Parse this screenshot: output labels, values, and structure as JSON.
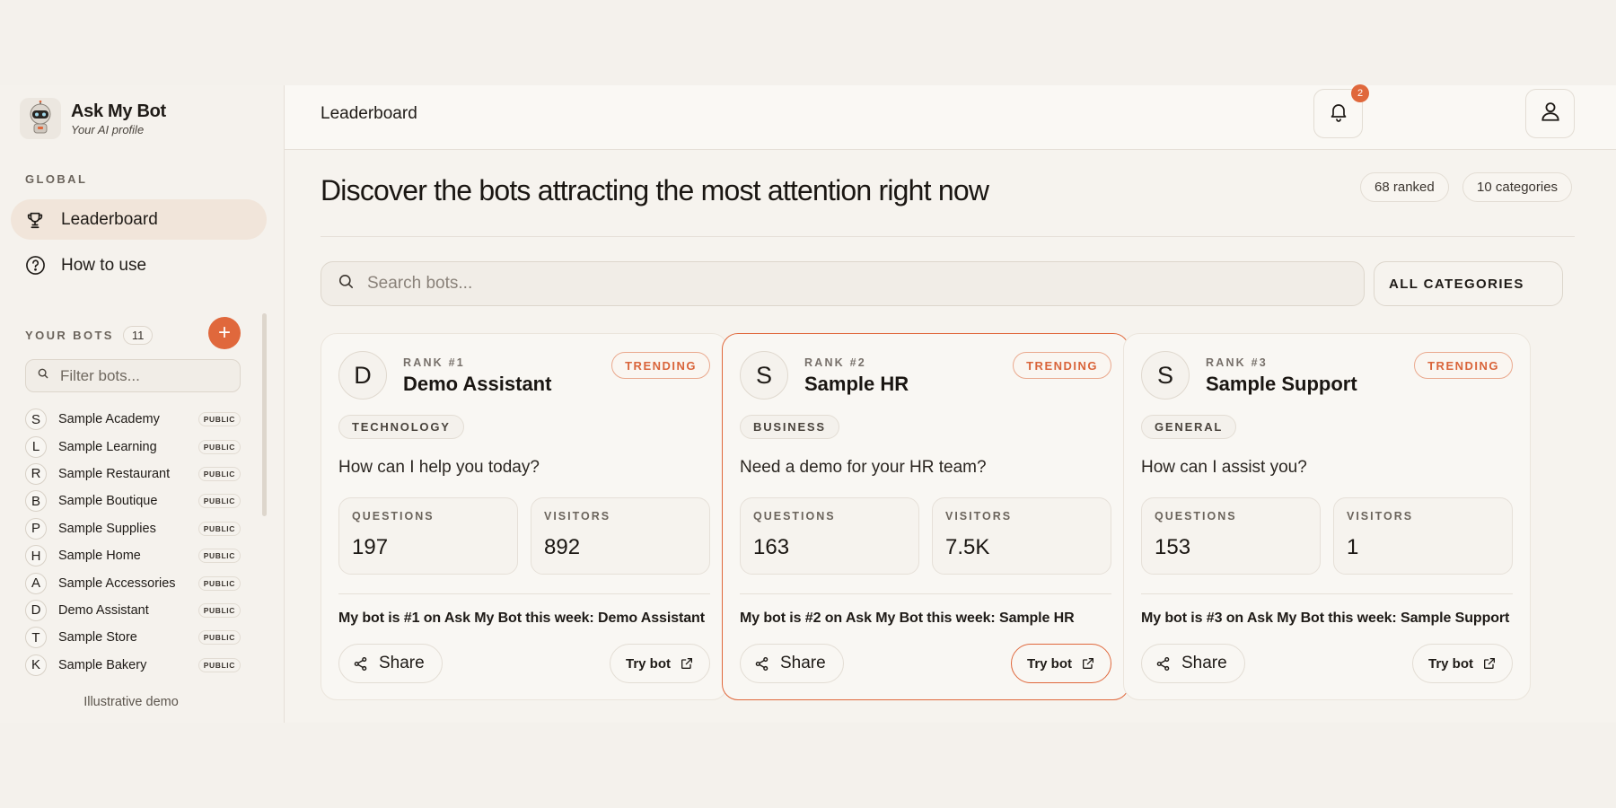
{
  "app": {
    "title": "Ask My Bot",
    "subtitle": "Your AI profile"
  },
  "sidebar": {
    "global_label": "GLOBAL",
    "nav": [
      {
        "label": "Leaderboard",
        "icon": "trophy-icon",
        "active": true
      },
      {
        "label": "How to use",
        "icon": "help-circle-icon",
        "active": false
      }
    ],
    "your_bots_label": "YOUR BOTS",
    "your_bots_count": "11",
    "filter_placeholder": "Filter bots...",
    "bots": [
      {
        "initial": "S",
        "name": "Sample Academy",
        "badge": "PUBLIC"
      },
      {
        "initial": "L",
        "name": "Sample Learning",
        "badge": "PUBLIC"
      },
      {
        "initial": "R",
        "name": "Sample Restaurant",
        "badge": "PUBLIC"
      },
      {
        "initial": "B",
        "name": "Sample Boutique",
        "badge": "PUBLIC"
      },
      {
        "initial": "P",
        "name": "Sample Supplies",
        "badge": "PUBLIC"
      },
      {
        "initial": "H",
        "name": "Sample Home",
        "badge": "PUBLIC"
      },
      {
        "initial": "A",
        "name": "Sample Accessories",
        "badge": "PUBLIC"
      },
      {
        "initial": "D",
        "name": "Demo Assistant",
        "badge": "PUBLIC"
      },
      {
        "initial": "T",
        "name": "Sample Store",
        "badge": "PUBLIC"
      },
      {
        "initial": "K",
        "name": "Sample Bakery",
        "badge": "PUBLIC"
      }
    ],
    "footer_note": "Illustrative demo"
  },
  "header": {
    "breadcrumb": "Leaderboard",
    "notification_count": "2"
  },
  "main": {
    "headline": "Discover the bots attracting the most attention right now",
    "stats": {
      "ranked": "68 ranked",
      "categories": "10 categories"
    },
    "search_placeholder": "Search bots...",
    "category_filter": "ALL CATEGORIES",
    "cards": [
      {
        "initial": "D",
        "rank": "RANK #1",
        "name": "Demo Assistant",
        "trend": "TRENDING",
        "category": "TECHNOLOGY",
        "prompt": "How can I help you today?",
        "questions_label": "QUESTIONS",
        "questions": "197",
        "visitors_label": "VISITORS",
        "visitors": "892",
        "share_text": "My bot is #1 on Ask My Bot this week: Demo Assistant",
        "share_label": "Share",
        "try_label": "Try bot",
        "highlighted": false
      },
      {
        "initial": "S",
        "rank": "RANK #2",
        "name": "Sample HR",
        "trend": "TRENDING",
        "category": "BUSINESS",
        "prompt": "Need a demo for your HR team?",
        "questions_label": "QUESTIONS",
        "questions": "163",
        "visitors_label": "VISITORS",
        "visitors": "7.5K",
        "share_text": "My bot is #2 on Ask My Bot this week: Sample HR",
        "share_label": "Share",
        "try_label": "Try bot",
        "highlighted": true
      },
      {
        "initial": "S",
        "rank": "RANK #3",
        "name": "Sample Support",
        "trend": "TRENDING",
        "category": "GENERAL",
        "prompt": "How can I assist you?",
        "questions_label": "QUESTIONS",
        "questions": "153",
        "visitors_label": "VISITORS",
        "visitors": "1",
        "share_text": "My bot is #3 on Ask My Bot this week: Sample Support",
        "share_label": "Share",
        "try_label": "Try bot",
        "highlighted": false
      }
    ]
  },
  "colors": {
    "accent": "#e0683c",
    "background": "#f4f1ec",
    "active_nav": "#f1e5da"
  }
}
